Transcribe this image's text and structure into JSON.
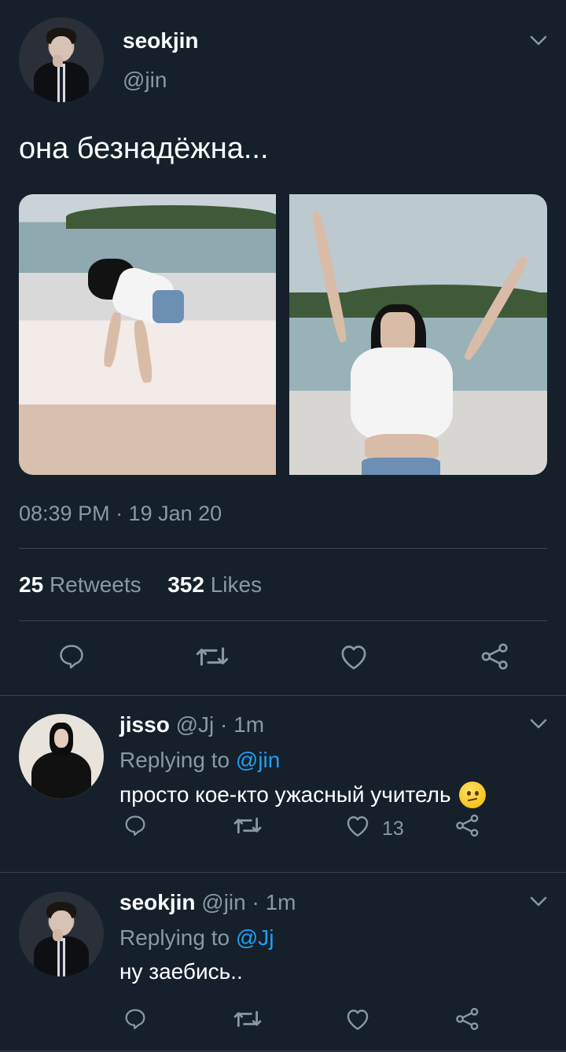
{
  "main_tweet": {
    "display_name": "seokjin",
    "handle": "@jin",
    "text": "она безнадёжна...",
    "timestamp": "08:39 PM · 19 Jan 20",
    "retweets_count": "25",
    "retweets_label": "Retweets",
    "likes_count": "352",
    "likes_label": "Likes"
  },
  "replies": [
    {
      "display_name": "jisso",
      "handle": "@Jj",
      "time": "· 1m",
      "replying_prefix": "Replying to",
      "replying_to": "@jin",
      "text": "просто кое-кто ужасный учитель",
      "emoji": "confused-face",
      "like_count": "13"
    },
    {
      "display_name": "seokjin",
      "handle": "@jin",
      "time": "· 1m",
      "replying_prefix": "Replying to",
      "replying_to": "@Jj",
      "text": "ну заебись.."
    }
  ],
  "icons": {
    "reply": "reply-icon",
    "retweet": "retweet-icon",
    "like": "heart-icon",
    "share": "share-icon",
    "more": "chevron-down-icon"
  },
  "colors": {
    "background": "#15202b",
    "text": "#ffffff",
    "muted": "#8899a6",
    "link": "#1da1f2",
    "divider": "#38444d"
  }
}
